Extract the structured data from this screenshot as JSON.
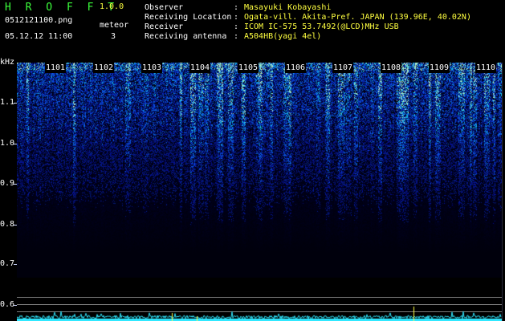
{
  "app": {
    "name": "H R O F F T",
    "version": "1.0.0",
    "file_name": "0512121100.png",
    "datetime": "05.12.12 11:00",
    "meteor_label": "meteor",
    "meteor_count": "3"
  },
  "info": [
    {
      "key": "Observer",
      "value": "Masayuki Kobayashi"
    },
    {
      "key": "Receiving Location",
      "value": "Ogata-vill. Akita-Pref. JAPAN (139.96E, 40.02N)"
    },
    {
      "key": "Receiver",
      "value": "ICOM IC-575 53.7492(@LCD)MHz USB"
    },
    {
      "key": "Receiving antenna",
      "value": "A504HB(yagi 4el)"
    }
  ],
  "spectrogram": {
    "unit_label": "kHz",
    "y_ticks": [
      "1.1",
      "1.0",
      "0.9",
      "0.8",
      "0.7",
      "0.6"
    ],
    "time_labels": [
      "1101",
      "1102",
      "1103",
      "1104",
      "1105",
      "1106",
      "1107",
      "1108",
      "1109",
      "1110"
    ]
  },
  "colors": {
    "title_green": "#3cff3c",
    "value_yellow": "#ffff40",
    "signal_cyan": "#30e8ff",
    "spike_yellow": "#ffff40",
    "reference_gray": "#7c7c7c"
  }
}
